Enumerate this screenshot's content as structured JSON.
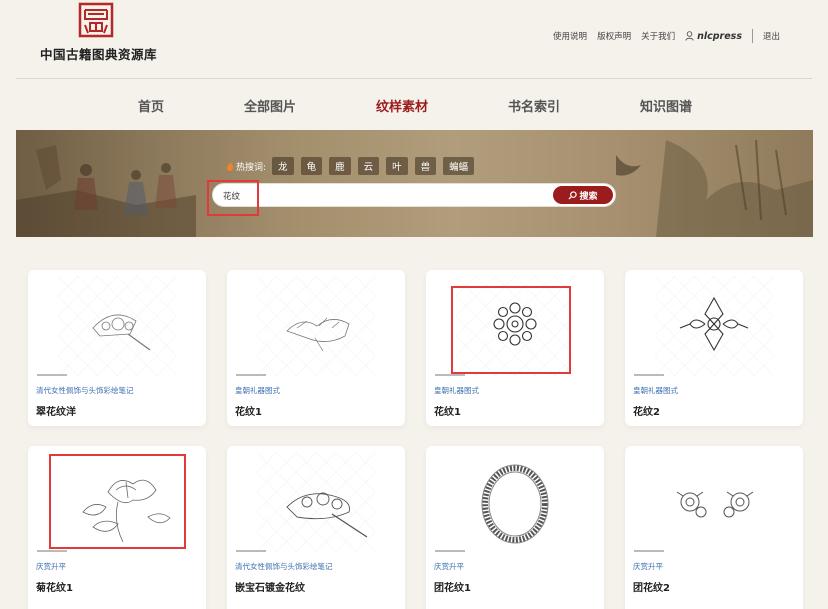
{
  "site": {
    "title": "中国古籍图典资源库",
    "logo_icon": "seal-logo-icon"
  },
  "top_links": {
    "help": "使用说明",
    "copyright": "版权声明",
    "about": "关于我们",
    "username": "nlcpress",
    "logout": "退出"
  },
  "nav": {
    "items": [
      {
        "label": "首页"
      },
      {
        "label": "全部图片"
      },
      {
        "label": "纹样素材"
      },
      {
        "label": "书名索引"
      },
      {
        "label": "知识图谱"
      }
    ],
    "active_index": 2
  },
  "hot": {
    "label": "热搜词:",
    "tags": [
      "龙",
      "龟",
      "鹿",
      "云",
      "叶",
      "兽",
      "蝙蝠"
    ]
  },
  "search": {
    "value": "花纹",
    "button": "搜索"
  },
  "colors": {
    "accent": "#9b1c1c",
    "highlight_box": "#e23a3a",
    "category": "#3a6fb0"
  },
  "cards": [
    {
      "category": "清代女性佩饰与头饰彩绘笔记",
      "title": "翠花纹洋"
    },
    {
      "category": "皇朝礼器图式",
      "title": "花纹1"
    },
    {
      "category": "皇朝礼器图式",
      "title": "花纹1"
    },
    {
      "category": "皇朝礼器图式",
      "title": "花纹2"
    },
    {
      "category": "庆赏升平",
      "title": "菊花纹1"
    },
    {
      "category": "清代女性佩饰与头饰彩绘笔记",
      "title": "嵌宝石镀金花纹"
    },
    {
      "category": "庆赏升平",
      "title": "团花纹1"
    },
    {
      "category": "庆赏升平",
      "title": "团花纹2"
    }
  ]
}
